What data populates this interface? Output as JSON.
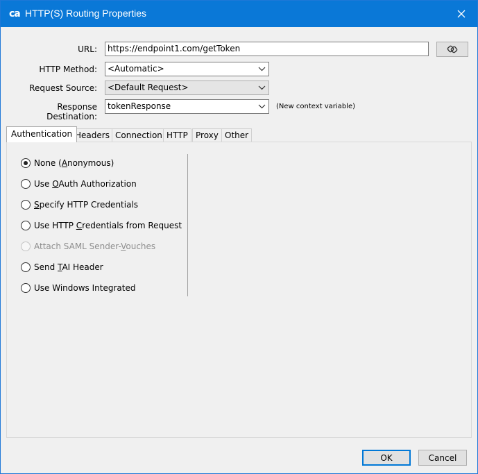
{
  "window": {
    "logo": "ca",
    "title": "HTTP(S) Routing Properties"
  },
  "form": {
    "url_label": "URL:",
    "url_value": "https://endpoint1.com/getToken",
    "http_method_label": "HTTP Method:",
    "http_method_value": "<Automatic>",
    "request_source_label": "Request Source:",
    "request_source_value": "<Default Request>",
    "response_destination_label": "Response Destination:",
    "response_destination_value": "tokenResponse",
    "response_destination_hint": "(New context variable)"
  },
  "tabs": [
    {
      "label": "Authentication",
      "active": true
    },
    {
      "label": "Headers"
    },
    {
      "label": "Connection"
    },
    {
      "label": "HTTP"
    },
    {
      "label": "Proxy"
    },
    {
      "label": "Other"
    }
  ],
  "auth_options": [
    {
      "pre": "None (",
      "mn": "A",
      "post": "nonymous)",
      "checked": true
    },
    {
      "pre": "Use ",
      "mn": "O",
      "post": "Auth Authorization"
    },
    {
      "pre": "",
      "mn": "S",
      "post": "pecify HTTP Credentials"
    },
    {
      "pre": "Use HTTP ",
      "mn": "C",
      "post": "redentials from Request"
    },
    {
      "pre": "Attach SAML Sender-",
      "mn": "V",
      "post": "ouches",
      "disabled": true
    },
    {
      "pre": "Send ",
      "mn": "T",
      "post": "AI Header"
    },
    {
      "pre": "Use Windows Integrated",
      "mn": "",
      "post": ""
    }
  ],
  "buttons": {
    "ok": "OK",
    "cancel": "Cancel"
  },
  "icons": {
    "close": "close-icon",
    "side_button": "link-chain-icon"
  },
  "colors": {
    "titlebar": "#0a78d7",
    "primary_button_border": "#0078d7"
  }
}
